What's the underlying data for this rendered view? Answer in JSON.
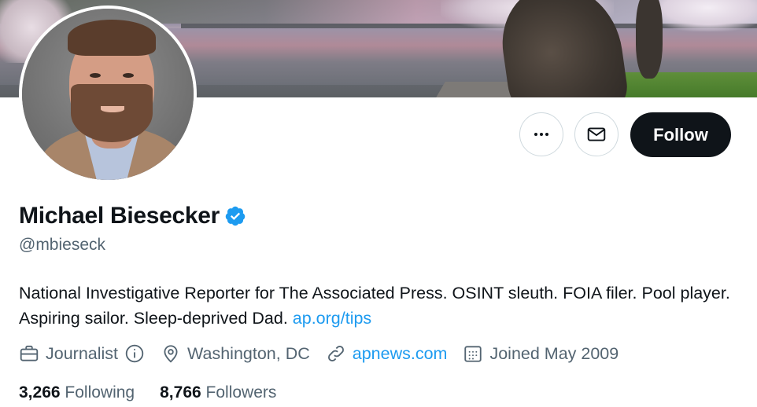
{
  "profile": {
    "name": "Michael Biesecker",
    "handle": "@mbieseck",
    "bio_text": "National Investigative Reporter for The Associated Press. OSINT sleuth. FOIA filer. Pool player. Aspiring sailor. Sleep-deprived Dad. ",
    "bio_link": "ap.org/tips",
    "verified": true,
    "accent_color": "#1d9bf0"
  },
  "actions": {
    "more_icon": "more-horizontal-icon",
    "message_icon": "envelope-icon",
    "follow_label": "Follow"
  },
  "meta": {
    "profession": "Journalist",
    "location": "Washington, DC",
    "website": "apnews.com",
    "joined": "Joined May 2009",
    "icons": [
      "briefcase-icon",
      "info-icon",
      "location-pin-icon",
      "link-icon",
      "calendar-icon"
    ]
  },
  "stats": {
    "following_count": "3,266",
    "following_label": "Following",
    "followers_count": "8,766",
    "followers_label": "Followers"
  }
}
